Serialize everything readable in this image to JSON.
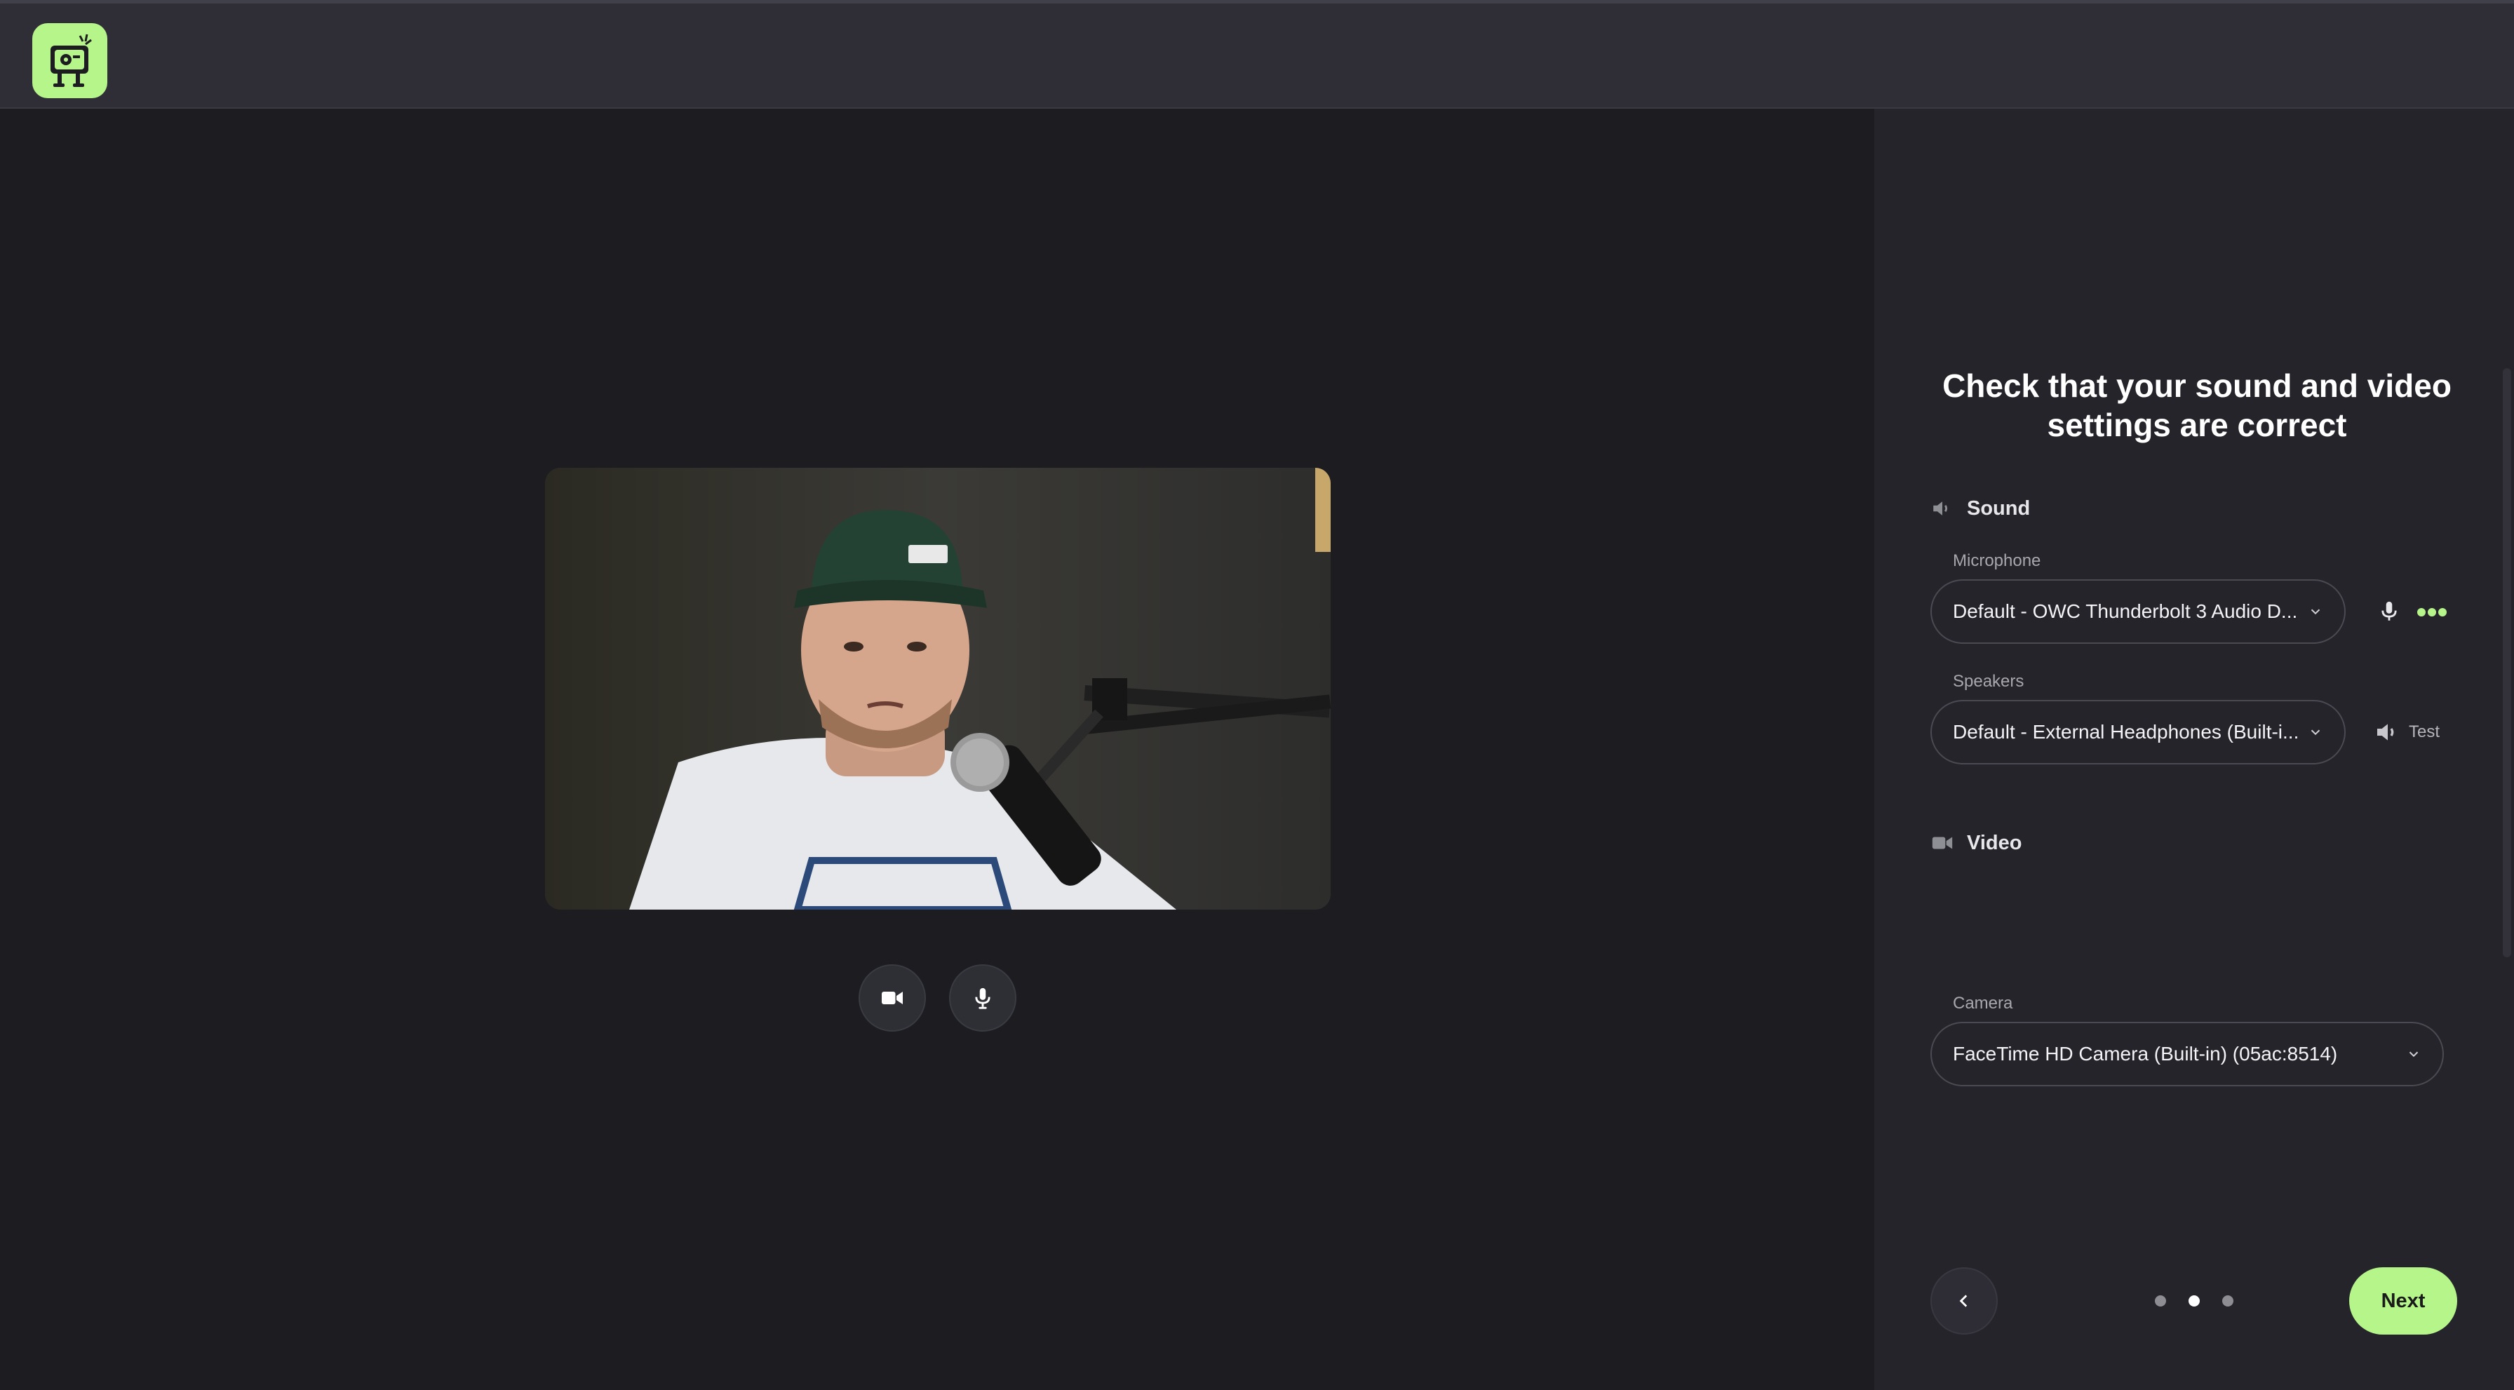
{
  "header": {
    "logo_icon": "robot-tv-logo",
    "accent": "#b5f58a"
  },
  "stage": {
    "preview_icon": "webcam-feed",
    "controls": [
      {
        "name": "camera-toggle",
        "icon": "video-camera-icon"
      },
      {
        "name": "mic-toggle",
        "icon": "microphone-icon"
      }
    ]
  },
  "panel": {
    "title": "Check that your sound and video settings are correct",
    "sound": {
      "heading": "Sound",
      "microphone_label": "Microphone",
      "microphone_value": "Default - OWC Thunderbolt 3 Audio D...",
      "speakers_label": "Speakers",
      "speakers_value": "Default - External Headphones (Built-i...",
      "test_label": "Test"
    },
    "video": {
      "heading": "Video",
      "camera_label": "Camera",
      "camera_value": "FaceTime HD Camera (Built-in) (05ac:8514)"
    },
    "nav": {
      "next_label": "Next",
      "pages_total": 3,
      "page_current": 2
    }
  }
}
